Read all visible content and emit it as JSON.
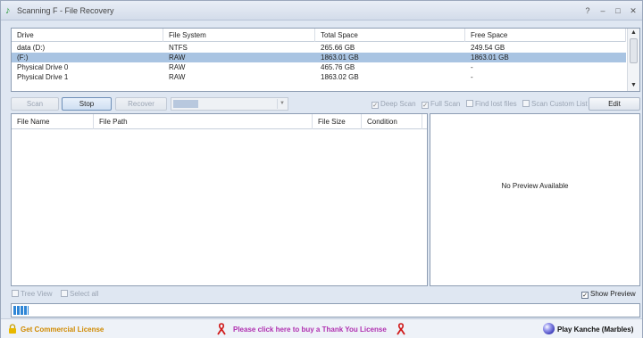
{
  "window": {
    "title": "Scanning F - File Recovery",
    "controls": [
      "?",
      "–",
      "□",
      "✕"
    ]
  },
  "drives": {
    "columns": [
      "Drive",
      "File System",
      "Total Space",
      "Free Space"
    ],
    "rows": [
      {
        "drive": "data (D:)",
        "fs": "NTFS",
        "total": "265.66 GB",
        "free": "249.54 GB",
        "selected": false
      },
      {
        "drive": "(F:)",
        "fs": "RAW",
        "total": "1863.01 GB",
        "free": "1863.01 GB",
        "selected": true
      },
      {
        "drive": "Physical Drive 0",
        "fs": "RAW",
        "total": "465.76 GB",
        "free": "-",
        "selected": false
      },
      {
        "drive": "Physical Drive 1",
        "fs": "RAW",
        "total": "1863.02 GB",
        "free": "-",
        "selected": false
      }
    ]
  },
  "toolbar": {
    "scan_label": "Scan",
    "stop_label": "Stop",
    "recover_label": "Recover",
    "edit_label": "Edit",
    "options": {
      "deep_scan": {
        "label": "Deep Scan",
        "checked": true
      },
      "full_scan": {
        "label": "Full Scan",
        "checked": true
      },
      "find_lost_files": {
        "label": "Find lost files",
        "checked": false
      },
      "scan_custom_list": {
        "label": "Scan Custom List",
        "checked": false
      }
    }
  },
  "files": {
    "columns": [
      "File Name",
      "File Path",
      "File Size",
      "Condition"
    ]
  },
  "preview": {
    "message": "No Preview Available",
    "show_preview_label": "Show Preview",
    "show_preview_checked": true
  },
  "bottom_options": {
    "tree_view_label": "Tree View",
    "select_all_label": "Select all"
  },
  "progress": {
    "value_percent": 2.5
  },
  "footer": {
    "commercial_label": "Get Commercial License",
    "thank_you_label": "Please click here to buy a Thank You License",
    "game_label": "Play Kanche (Marbles)",
    "commercial_color": "#d08a00",
    "thank_you_color": "#b030b0"
  },
  "icons": {
    "app": "app-logo-icon",
    "lock": "lock-icon",
    "ribbon": "ribbon-icon",
    "marble": "marble-icon"
  }
}
